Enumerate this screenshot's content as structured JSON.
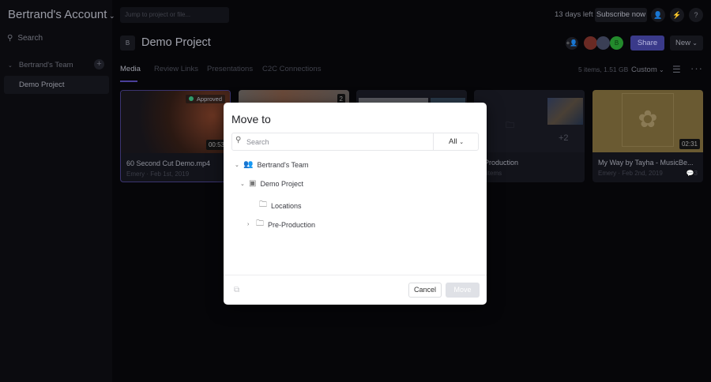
{
  "sidebar": {
    "account": "Bertrand's Account",
    "search": "Search",
    "team": "Bertrand's Team",
    "project": "Demo Project"
  },
  "topbar": {
    "jump_placeholder": "Jump to project or file...",
    "days_left": "13 days left",
    "subscribe": "Subscribe now"
  },
  "project": {
    "badge": "B",
    "title": "Demo Project",
    "avatar_initial": "B",
    "share": "Share",
    "new": "New"
  },
  "tabs": [
    "Media",
    "Review Links",
    "Presentations",
    "C2C Connections"
  ],
  "toolbar": {
    "count": "5 items, 1.51 GB",
    "sort": "Custom"
  },
  "cards": [
    {
      "title": "60 Second Cut Demo.mp4",
      "meta": "Emery · Feb 1st, 2019",
      "status": "Approved",
      "duration": "00:53"
    },
    {
      "version": "2"
    },
    {},
    {
      "title": "Pre-Production",
      "meta": "items",
      "more": "+2"
    },
    {
      "title": "My Way by Tayha - MusicBe...",
      "meta": "Emery · Feb 2nd, 2019",
      "duration": "02:31",
      "comments": "3"
    }
  ],
  "dialog": {
    "title": "Move to",
    "search_placeholder": "Search",
    "filter": "All",
    "tree": [
      "Bertrand's Team",
      "Demo Project",
      "Locations",
      "Pre-Production"
    ],
    "cancel": "Cancel",
    "move": "Move"
  },
  "colors": {
    "accent": "#3a3a8a",
    "approved": "#2f9a6a"
  }
}
